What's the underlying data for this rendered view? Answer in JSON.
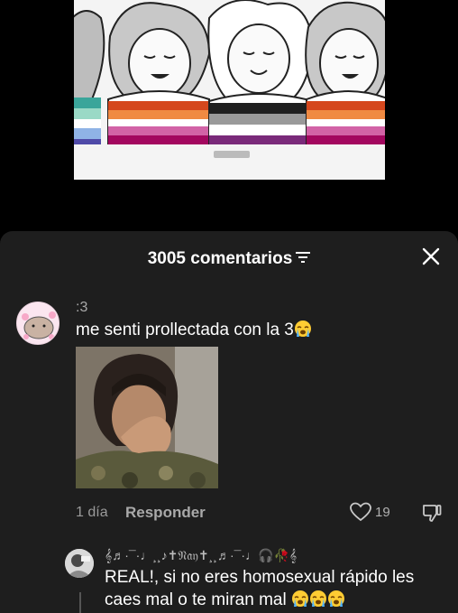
{
  "header": {
    "comment_count": "3005 comentarios"
  },
  "comment": {
    "username": ":3",
    "text": "me senti prollectada con la 3",
    "emoji": "loudly-crying-face",
    "time": "1 día",
    "reply_label": "Responder",
    "likes": "19"
  },
  "reply": {
    "username": "𝄞♬·¯·♩¸¸♪✝𝔑𝔞𝔶✝¸¸♬·¯·♩🎧🥀𝄞",
    "text": "REAL!, si no eres homosexual rápido les caes mal o te miran mal",
    "emoji_count": 3
  },
  "video_thumbnail": {
    "watermark": "",
    "stripe_colors": [
      "#3aa59a",
      "#ffffff",
      "#e8813a",
      "#c9417d",
      "#9a9a9a",
      "#333333"
    ]
  },
  "colors": {
    "sheet_bg": "#1e1e1e",
    "text_primary": "#ffffff",
    "text_secondary": "#a9a9a9"
  }
}
